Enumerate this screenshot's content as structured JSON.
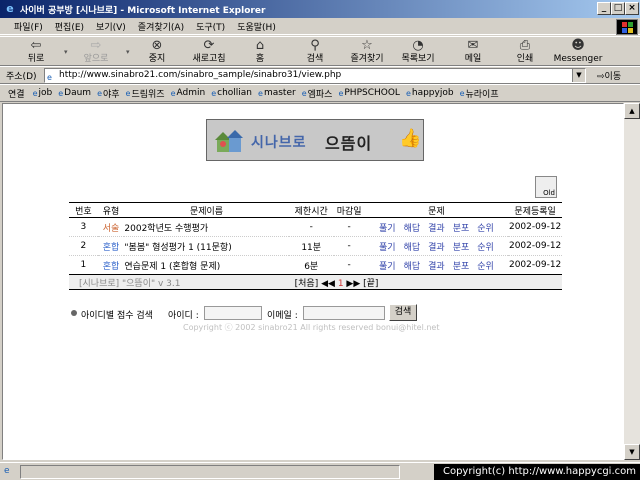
{
  "window": {
    "title": "사이버 공부방 [시나브로] - Microsoft Internet Explorer"
  },
  "menu": [
    "파일(F)",
    "편집(E)",
    "보기(V)",
    "즐겨찾기(A)",
    "도구(T)",
    "도움말(H)"
  ],
  "toolbar": {
    "back": "뒤로",
    "forward": "앞으로",
    "stop": "중지",
    "refresh": "새로고침",
    "home": "홈",
    "search": "검색",
    "favorites": "즐겨찾기",
    "history": "목록보기",
    "mail": "메일",
    "print": "인쇄",
    "messenger": "Messenger"
  },
  "address": {
    "label": "주소(D)",
    "url": "http://www.sinabro21.com/sinabro_sample/sinabro31/view.php",
    "go": "이동"
  },
  "links": {
    "label": "연결",
    "items": [
      "job",
      "Daum",
      "야후",
      "드림위즈",
      "Admin",
      "chollian",
      "master",
      "엠파스",
      "PHPSCHOOL",
      "happyjob",
      "뉴라이프"
    ]
  },
  "logo": {
    "name": "시나브로",
    "sub": "으뜸이"
  },
  "old_button": "Old",
  "table": {
    "headers": [
      "번호",
      "유형",
      "문제이름",
      "제한시간",
      "마감일",
      "문제",
      "문제등록일"
    ],
    "actions": [
      "풀기",
      "해답",
      "결과",
      "분포",
      "순위"
    ],
    "rows": [
      {
        "no": "3",
        "type": "서술",
        "title": "2002학년도 수행평가",
        "limit": "-",
        "deadline": "-",
        "date": "2002-09-12"
      },
      {
        "no": "2",
        "type": "혼합",
        "title": "\"봄봄\" 형성평가 1 (11문항)",
        "limit": "11분",
        "deadline": "-",
        "date": "2002-09-12"
      },
      {
        "no": "1",
        "type": "혼합",
        "title": "연습문제 1 (혼합형 문제)",
        "limit": "6분",
        "deadline": "-",
        "date": "2002-09-12"
      }
    ],
    "footer_version": "[시나브로] \"으뜸이\" v 3.1",
    "pager": {
      "first": "[처음]",
      "prev": "◀◀",
      "current": "1",
      "next": "▶▶",
      "last": "[끝]"
    }
  },
  "search": {
    "title": "아이디별 점수 검색",
    "id_label": "아이디 :",
    "email_label": "이메일 :",
    "button": "검색"
  },
  "copyright_inner": "Copyright ⓒ 2002 sinabro21 All rights reserved    bonui@hitel.net",
  "copyright_overlay": "Copyright(c) http://www.happycgi.com"
}
